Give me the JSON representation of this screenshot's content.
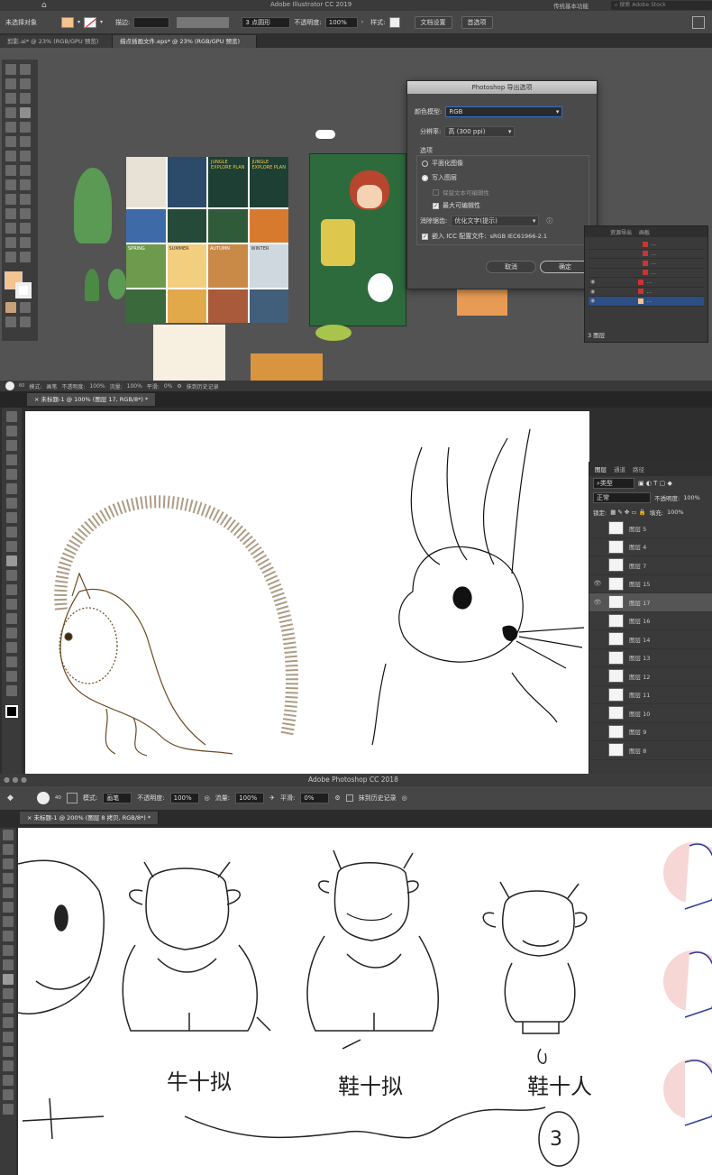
{
  "ai": {
    "window_title": "Adobe Illustrator CC 2019",
    "workspace": "传统基本功能",
    "stock_search": "搜索 Adobe Stock",
    "control": {
      "no_selection": "未选择对象",
      "stroke_label": "描边:",
      "brush": "3 点圆形",
      "opacity_label": "不透明度:",
      "opacity": "100%",
      "style_label": "样式:",
      "doc_setup": "文档设置",
      "prefs": "首选项"
    },
    "tabs": [
      "剪影.ai* @ 23% (RGB/GPU 预览)",
      "描点插画文件.eps* @ 23% (RGB/GPU 预览)"
    ],
    "dialog": {
      "title": "Photoshop 导出选项",
      "color_model_label": "颜色模型:",
      "color_model": "RGB",
      "resolution_label": "分辨率:",
      "resolution": "高 (300 ppi)",
      "options_label": "选项",
      "flat_image": "平面化图像",
      "write_layers": "写入图层",
      "keep_text": "保留文本可编辑性",
      "max_edit": "最大可编辑性",
      "antialias_label": "消除锯齿:",
      "antialias": "优化文字(提示)",
      "embed_icc": "嵌入 ICC 配置文件:",
      "icc_profile": "sRGB IEC61966-2.1",
      "cancel": "取消",
      "ok": "确定"
    },
    "layers_panel": {
      "tabs": [
        "资源导出",
        "画板"
      ],
      "count": "3 图层"
    },
    "posters": [
      "JUNGLE EXPLORE PLAN",
      "JUNGLE EXPLORE PLAN",
      "SPRING",
      "SUMMER",
      "AUTUMN",
      "WINTER"
    ]
  },
  "ps1": {
    "options": {
      "brush_size": "60",
      "mode_label": "模式:",
      "mode": "画笔",
      "opacity_label": "不透明度:",
      "opacity": "100%",
      "flow_label": "流量:",
      "flow": "100%",
      "smooth_label": "平滑:",
      "smooth": "0%",
      "history": "抹到历史记录"
    },
    "tab": "未标题-1 @ 100% (图层 17, RGB/8*) *",
    "layers": {
      "tabs": [
        "图层",
        "通道",
        "路径"
      ],
      "kind": "类型",
      "blend": "正常",
      "opacity_label": "不透明度:",
      "opacity": "100%",
      "lock_label": "锁定:",
      "fill_label": "填充:",
      "fill": "100%",
      "items": [
        {
          "name": "图层 5",
          "eye": ""
        },
        {
          "name": "图层 4",
          "eye": ""
        },
        {
          "name": "图层 7",
          "eye": ""
        },
        {
          "name": "图层 15",
          "eye": "👁"
        },
        {
          "name": "图层 17",
          "eye": "👁"
        },
        {
          "name": "图层 16",
          "eye": ""
        },
        {
          "name": "图层 14",
          "eye": ""
        },
        {
          "name": "图层 13",
          "eye": ""
        },
        {
          "name": "图层 12",
          "eye": ""
        },
        {
          "name": "图层 11",
          "eye": ""
        },
        {
          "name": "图层 10",
          "eye": ""
        },
        {
          "name": "图层 9",
          "eye": ""
        },
        {
          "name": "图层 8",
          "eye": ""
        }
      ]
    }
  },
  "ps2": {
    "window_title": "Adobe Photoshop CC 2018",
    "options": {
      "brush_size": "40",
      "mode_label": "模式:",
      "mode": "画笔",
      "opacity_label": "不透明度:",
      "opacity": "100%",
      "flow_label": "流量:",
      "flow": "100%",
      "smooth_label": "平滑:",
      "smooth": "0%",
      "history": "抹到历史记录"
    },
    "tab": "未标题-1 @ 200% (图层 8 拷贝, RGB/8*) *",
    "sketch_labels": [
      "牛十拟",
      "鞋十拟",
      "鞋十人"
    ],
    "circle_number": "3"
  },
  "colors": {
    "ai_bg": "#5a5a5a",
    "ps_canvas": "#ffffff",
    "swatch": "#f5c38e",
    "accent": "#2d6fd2",
    "brown_ink": "#6a4a23"
  }
}
